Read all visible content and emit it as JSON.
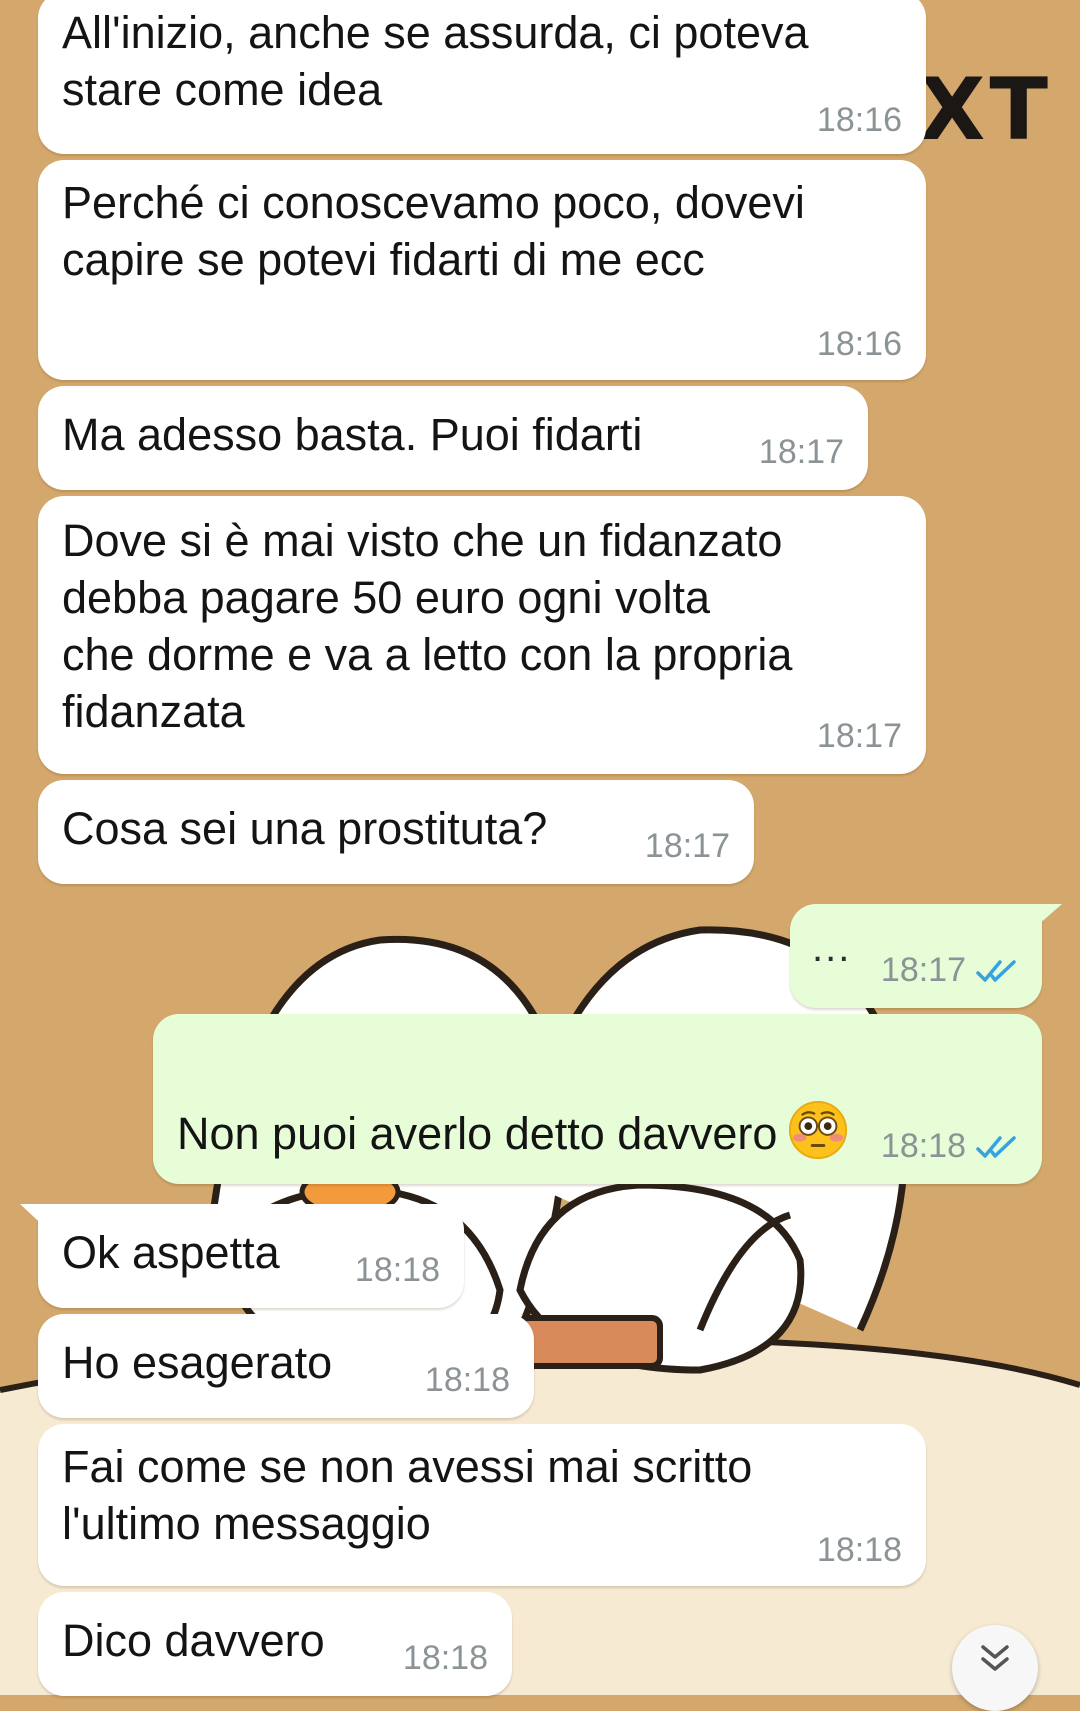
{
  "wallpaper": {
    "overlay_text": "XT"
  },
  "messages": [
    {
      "direction": "in",
      "text": "All'inizio, anche se assurda, ci poteva\nstare come idea",
      "time": "18:16"
    },
    {
      "direction": "in",
      "text": "Perché ci conoscevamo poco, dovevi\ncapire se potevi fidarti di me ecc",
      "time": "18:16"
    },
    {
      "direction": "in",
      "text": "Ma adesso basta. Puoi fidarti",
      "time": "18:17"
    },
    {
      "direction": "in",
      "text": "Dove si è mai visto che un fidanzato\ndebba pagare 50 euro ogni volta\nche dorme e va a letto con la propria\nfidanzata",
      "time": "18:17"
    },
    {
      "direction": "in",
      "text": "Cosa sei una prostituta?",
      "time": "18:17"
    },
    {
      "direction": "out",
      "text": "...",
      "time": "18:17",
      "status": "read"
    },
    {
      "direction": "out",
      "text": "Non puoi averlo detto davvero",
      "emoji": "flushed-face-emoji",
      "time": "18:18",
      "status": "read"
    },
    {
      "direction": "in",
      "text": "Ok aspetta",
      "time": "18:18"
    },
    {
      "direction": "in",
      "text": "Ho esagerato",
      "time": "18:18"
    },
    {
      "direction": "in",
      "text": "Fai come se non avessi mai scritto\nl'ultimo messaggio",
      "time": "18:18"
    },
    {
      "direction": "in",
      "text": "Dico davvero",
      "time": "18:18"
    }
  ],
  "scroll_button": {
    "icon": "double-chevron-down-icon"
  },
  "colors": {
    "incoming_bubble": "#ffffff",
    "outgoing_bubble": "#e6fdd8",
    "read_ticks": "#34a3e0",
    "timestamp": "#8c9396",
    "wallpaper": "#d4a86c"
  }
}
